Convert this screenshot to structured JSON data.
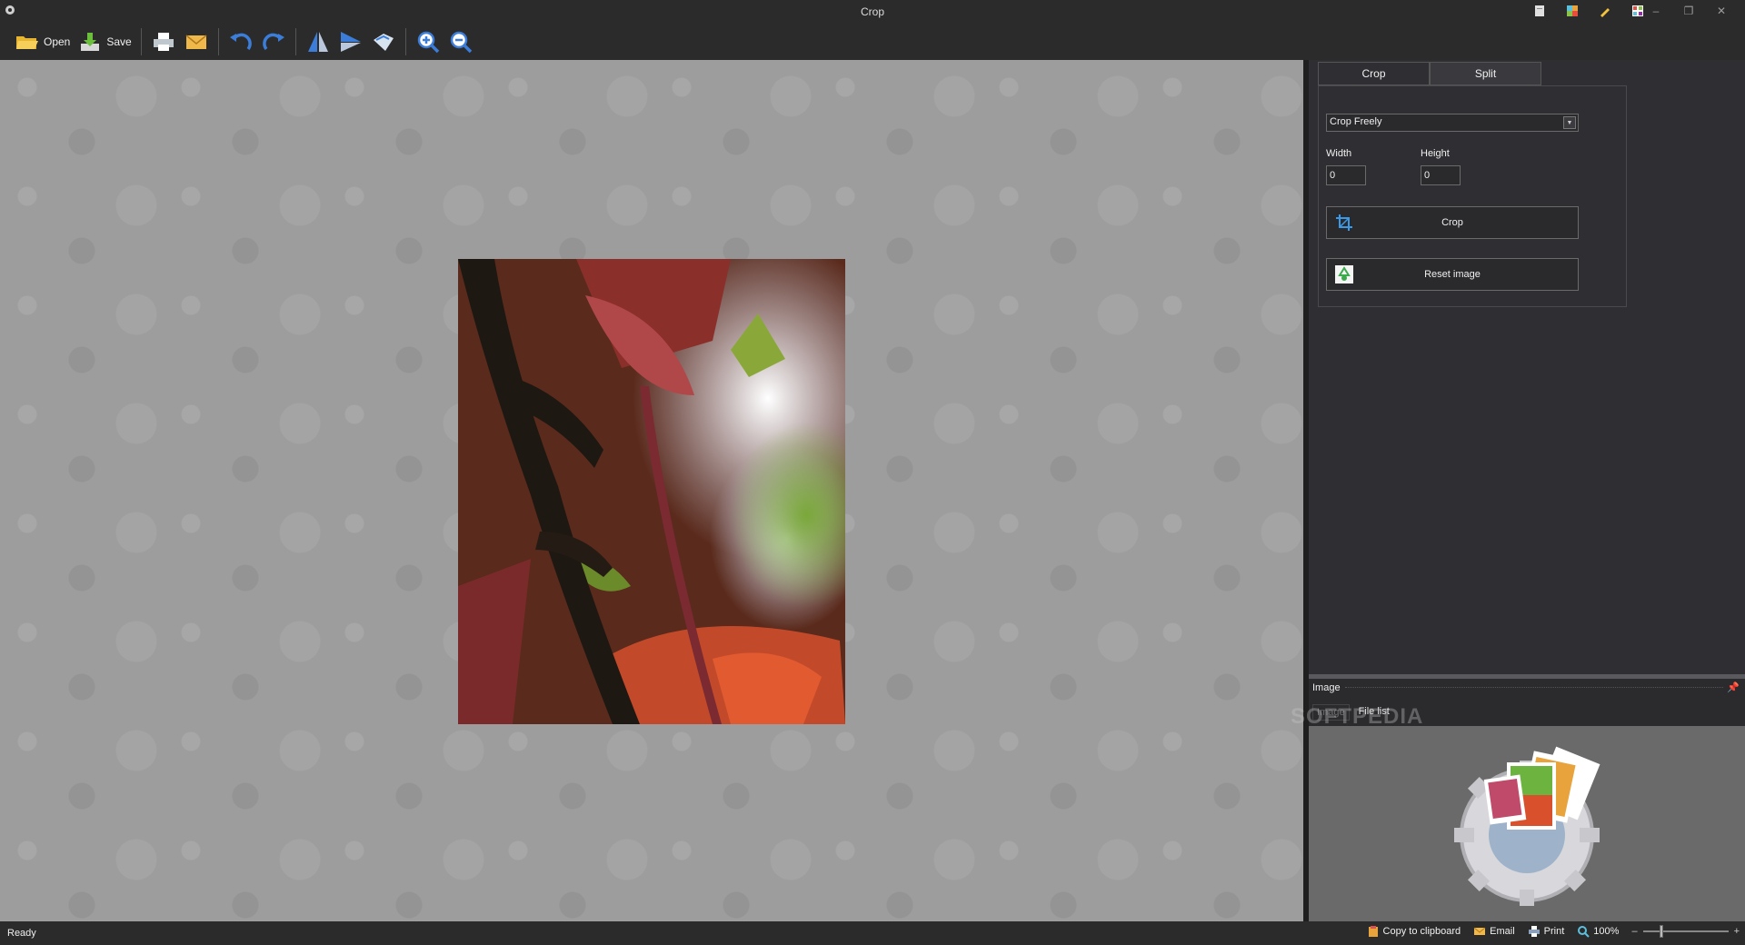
{
  "window": {
    "title": "Crop"
  },
  "toolbar": {
    "open_label": "Open",
    "save_label": "Save"
  },
  "tabs": [
    {
      "label": "Crop"
    },
    {
      "label": "Split"
    }
  ],
  "crop_panel": {
    "mode_value": "Crop Freely",
    "width_label": "Width",
    "height_label": "Height",
    "width_value": "0",
    "height_value": "0",
    "crop_button": "Crop",
    "reset_button": "Reset image"
  },
  "dock": {
    "title": "Image",
    "tabs": [
      {
        "label": "Image"
      },
      {
        "label": "File list"
      }
    ]
  },
  "watermark": "SOFTPEDIA",
  "statusbar": {
    "status": "Ready",
    "copy_label": "Copy to clipboard",
    "email_label": "Email",
    "print_label": "Print",
    "zoom": "100%",
    "minus": "–",
    "plus": "+"
  }
}
